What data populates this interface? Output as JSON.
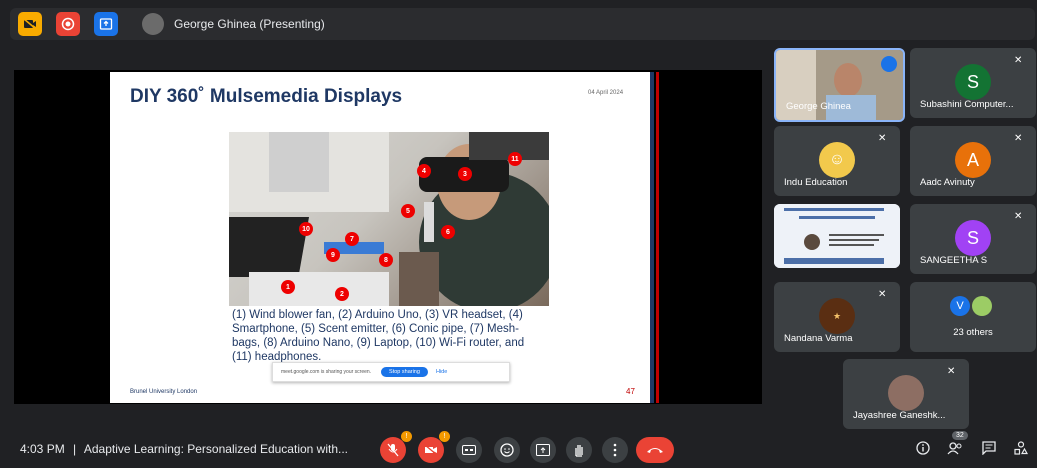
{
  "top_bar": {
    "presenter_label": "George Ghinea (Presenting)"
  },
  "slide": {
    "title": "DIY 360˚ Mulsemedia Displays",
    "date": "04 April 2024",
    "caption": "(1) Wind blower fan, (2) Arduino Uno, (3) VR headset, (4) Smartphone, (5) Scent emitter, (6) Conic pipe, (7) Mesh-bags, (8) Arduino Nano, (9) Laptop, (10) Wi-Fi router, and (11) headphones.",
    "footer_left": "Brunel University London",
    "page_number": "47",
    "photo_markers": [
      "1",
      "2",
      "3",
      "4",
      "5",
      "6",
      "7",
      "8",
      "9",
      "10",
      "11"
    ]
  },
  "share_bar": {
    "message": "meet.google.com is sharing your screen.",
    "stop_label": "Stop sharing",
    "hide_label": "Hide"
  },
  "participants": [
    {
      "name": "George Ghinea"
    },
    {
      "name": "Subashini Computer...",
      "initial": "S",
      "color": "#137333"
    },
    {
      "name": "Indu Education"
    },
    {
      "name": "Aadc Avinuty",
      "initial": "A",
      "color": "#e8710a"
    },
    {
      "name": "SANGEETHA S",
      "initial": "S",
      "color": "#a142f4"
    },
    {
      "name": "Nandana Varma"
    },
    {
      "name": "23 others",
      "initial": "V",
      "color": "#1a73e8"
    },
    {
      "name": "Jayashree Ganeshk..."
    }
  ],
  "bottom_bar": {
    "time": "4:03 PM",
    "separator": "|",
    "meeting_title": "Adaptive Learning: Personalized Education with...",
    "participant_count": "32",
    "mic_badge": "!",
    "cam_badge": "!"
  },
  "colors": {
    "accent": "#1a73e8",
    "end_call": "#ea4335",
    "slide_title": "#1f3864"
  }
}
